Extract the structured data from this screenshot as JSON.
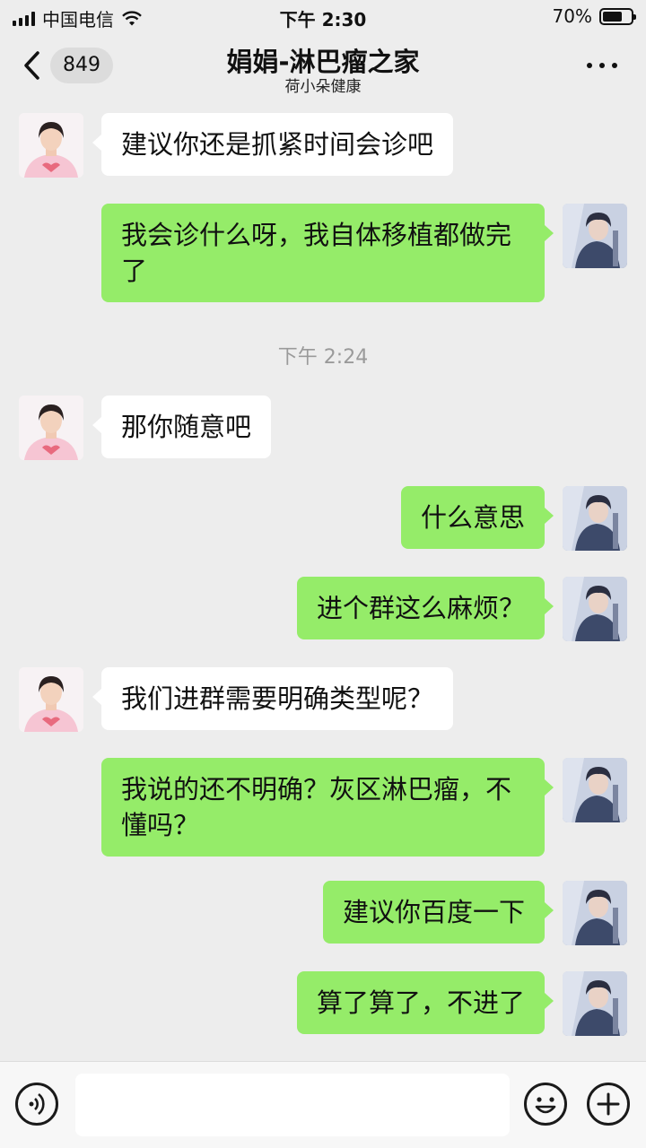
{
  "status_bar": {
    "carrier": "中国电信",
    "time": "下午 2:30",
    "battery": "70%",
    "battery_level": 0.7
  },
  "nav": {
    "back_icon": "chevron-left-icon",
    "unread_count": "849",
    "title": "娟娟-淋巴瘤之家",
    "subtitle": "荷小朵健康",
    "more_icon": "more-dots-icon"
  },
  "messages": [
    {
      "side": "in",
      "text": "建议你还是抓紧时间会诊吧"
    },
    {
      "side": "out",
      "text": "我会诊什么呀，我自体移植都做完了"
    },
    {
      "side": "in",
      "text": "那你随意吧"
    },
    {
      "side": "out",
      "text": "什么意思"
    },
    {
      "side": "out",
      "text": "进个群这么麻烦？"
    },
    {
      "side": "in",
      "text": "我们进群需要明确类型呢？"
    },
    {
      "side": "out",
      "text": "我说的还不明确？灰区淋巴瘤，不懂吗？"
    },
    {
      "side": "out",
      "text": "建议你百度一下"
    },
    {
      "side": "out",
      "text": "算了算了，不进了"
    }
  ],
  "timestamp": "下午 2:24",
  "input_bar": {
    "voice_icon": "voice-icon",
    "emoji_icon": "emoji-icon",
    "plus_icon": "plus-icon",
    "text_value": ""
  },
  "colors": {
    "background": "#ededed",
    "outgoing_bubble": "#95ec69",
    "incoming_bubble": "#ffffff"
  }
}
